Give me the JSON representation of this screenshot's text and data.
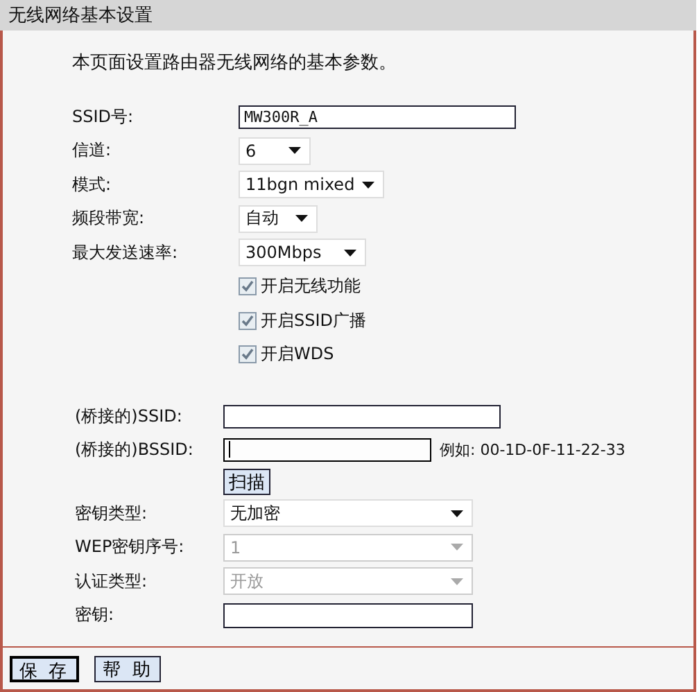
{
  "window": {
    "title": "无线网络基本设置"
  },
  "intro": "本页面设置路由器无线网络的基本参数。",
  "basic_fields": [
    {
      "kind": "text",
      "label": "SSID号:",
      "value": "MW300R_A"
    },
    {
      "kind": "select",
      "label": "信道:",
      "value": "6"
    },
    {
      "kind": "select",
      "label": "模式:",
      "value": "11bgn mixed"
    },
    {
      "kind": "select",
      "label": "频段带宽:",
      "value": "自动"
    },
    {
      "kind": "select",
      "label": "最大发送速率:",
      "value": "300Mbps"
    }
  ],
  "checkboxes": [
    {
      "label": "开启无线功能",
      "checked": true
    },
    {
      "label": "开启SSID广播",
      "checked": true
    },
    {
      "label": "开启WDS",
      "checked": true
    }
  ],
  "bridge_fields": [
    {
      "kind": "text",
      "label": "(桥接的)SSID:",
      "focused": false
    },
    {
      "kind": "text",
      "label": "(桥接的)BSSID:",
      "focused": true,
      "hint": "例如: 00-1D-0F-11-22-33"
    }
  ],
  "scan_button": "扫描",
  "security_fields": [
    {
      "kind": "select",
      "label": "密钥类型:",
      "value": "无加密",
      "disabled": false
    },
    {
      "kind": "select",
      "label": "WEP密钥序号:",
      "value": "1",
      "disabled": true
    },
    {
      "kind": "select",
      "label": "认证类型:",
      "value": "开放",
      "disabled": true
    },
    {
      "kind": "text",
      "label": "密钥:",
      "disabled": false
    }
  ],
  "buttons": [
    {
      "label": "保 存",
      "focused": true
    },
    {
      "label": "帮 助",
      "focused": false
    }
  ]
}
